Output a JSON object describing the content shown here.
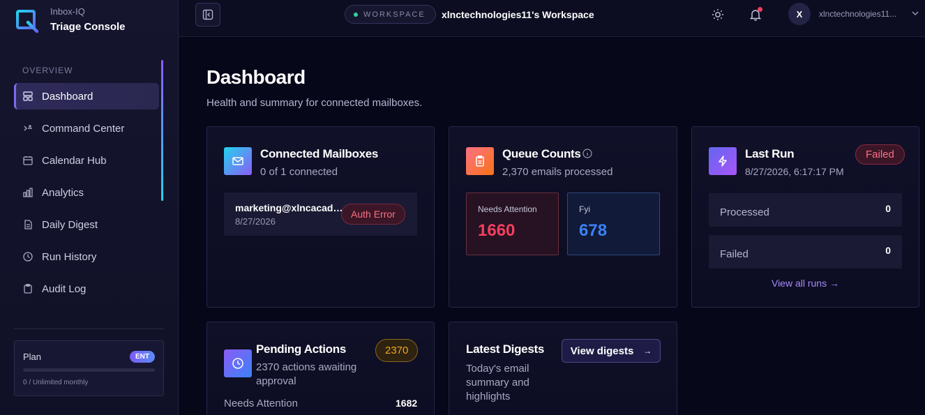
{
  "brand": {
    "sub": "Inbox-IQ",
    "title": "Triage Console"
  },
  "sidebar": {
    "section": "OVERVIEW",
    "items": [
      {
        "label": "Dashboard",
        "icon": "dashboard-icon",
        "active": true
      },
      {
        "label": "Command Center",
        "icon": "command-icon"
      },
      {
        "label": "Calendar Hub",
        "icon": "calendar-icon"
      },
      {
        "label": "Analytics",
        "icon": "analytics-icon"
      },
      {
        "label": "Daily Digest",
        "icon": "document-icon"
      },
      {
        "label": "Run History",
        "icon": "clock-icon"
      },
      {
        "label": "Audit Log",
        "icon": "clipboard-icon"
      }
    ],
    "plan": {
      "label": "Plan",
      "badge": "ENT",
      "usage": "0 / Unlimited monthly",
      "usage_fraction": 0
    }
  },
  "topbar": {
    "workspace_label": "WORKSPACE",
    "workspace_name": "xlnctechnologies11's Workspace",
    "avatar_letter": "X",
    "user_name": "xlnctechnologies11..."
  },
  "page": {
    "title": "Dashboard",
    "subtitle": "Health and summary for connected mailboxes."
  },
  "mailboxes": {
    "title": "Connected Mailboxes",
    "subtitle": "0 of 1 connected",
    "items": [
      {
        "email": "marketing@xlncacademy.com",
        "date": "8/27/2026",
        "status": "Auth Error"
      }
    ]
  },
  "queue": {
    "title": "Queue Counts",
    "subtitle": "2,370 emails processed",
    "boxes": [
      {
        "label": "Needs Attention",
        "value": "1660"
      },
      {
        "label": "Fyi",
        "value": "678"
      }
    ]
  },
  "last_run": {
    "title": "Last Run",
    "timestamp": "8/27/2026, 6:17:17 PM",
    "status": "Failed",
    "rows": [
      {
        "label": "Processed",
        "value": "0"
      },
      {
        "label": "Failed",
        "value": "0"
      }
    ],
    "link": "View all runs →"
  },
  "pending": {
    "title": "Pending Actions",
    "subtitle_line1": "2370 actions awaiting",
    "subtitle_line2": "approval",
    "count": "2370",
    "row_label": "Needs Attention",
    "row_value": "1682"
  },
  "digests": {
    "title": "Latest Digests",
    "line1": "Today's email",
    "line2": "summary and",
    "line3": "highlights",
    "button": "View digests"
  },
  "colors": {
    "accent": "#7a6cf0",
    "needs_attention": "#f43f5e",
    "fyi": "#3b82f6",
    "pending": "#f5a524",
    "link": "#a78bfa"
  }
}
